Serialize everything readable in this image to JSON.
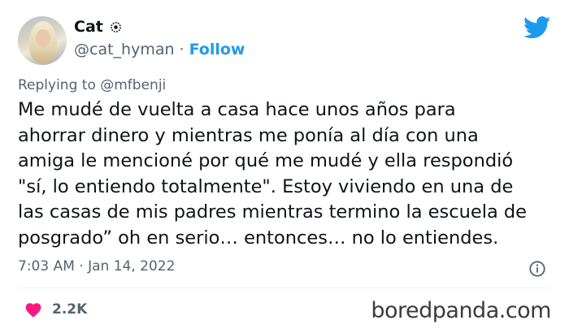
{
  "author": {
    "display_name": "Cat",
    "handle": "@cat_hyman",
    "separator": "·",
    "follow_label": "Follow"
  },
  "reply": {
    "prefix": "Replying to",
    "mention": "@mfbenji"
  },
  "tweet": {
    "text": "Me mudé de vuelta a casa hace unos años para\nahorrar dinero y mientras me ponía al día con una\namiga le mencioné por qué me mudé y ella respondió\n\"sí, lo entiendo totalmente\". Estoy viviendo en una de\nlas casas de mis padres mientras termino la escuela de\nposgrado” oh en serio… entonces… no lo entiendes.",
    "timestamp": "7:03 AM · Jan 14, 2022"
  },
  "engagement": {
    "likes": "2.2K"
  },
  "watermark": "boredpanda.com",
  "colors": {
    "twitter_blue": "#1d9bf0",
    "heart_red": "#f91880",
    "muted": "#536471"
  },
  "icons": [
    "verified-badge-icon",
    "twitter-bird-icon",
    "info-icon",
    "heart-icon"
  ]
}
